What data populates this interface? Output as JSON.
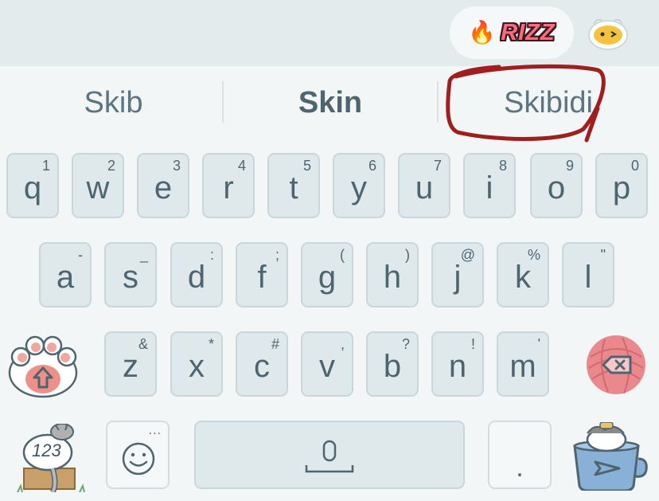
{
  "toolbar": {
    "badge_text": "RIZZ",
    "badge_emoji": "🔥",
    "mascot_icon": "ghost-face-icon"
  },
  "suggestions": [
    "Skib",
    "Skin",
    "Skibidi"
  ],
  "row1": [
    {
      "key": "q",
      "hint": "1"
    },
    {
      "key": "w",
      "hint": "2"
    },
    {
      "key": "e",
      "hint": "3"
    },
    {
      "key": "r",
      "hint": "4"
    },
    {
      "key": "t",
      "hint": "5"
    },
    {
      "key": "y",
      "hint": "6"
    },
    {
      "key": "u",
      "hint": "7"
    },
    {
      "key": "i",
      "hint": "8"
    },
    {
      "key": "o",
      "hint": "9"
    },
    {
      "key": "p",
      "hint": "0"
    }
  ],
  "row2": [
    {
      "key": "a",
      "hint": "-"
    },
    {
      "key": "s",
      "hint": "_"
    },
    {
      "key": "d",
      "hint": ":"
    },
    {
      "key": "f",
      "hint": ";"
    },
    {
      "key": "g",
      "hint": "("
    },
    {
      "key": "h",
      "hint": ")"
    },
    {
      "key": "j",
      "hint": "@"
    },
    {
      "key": "k",
      "hint": "%"
    },
    {
      "key": "l",
      "hint": "\""
    }
  ],
  "row3": [
    {
      "key": "z",
      "hint": "&"
    },
    {
      "key": "x",
      "hint": "*"
    },
    {
      "key": "c",
      "hint": "#"
    },
    {
      "key": "v",
      "hint": ","
    },
    {
      "key": "b",
      "hint": "?"
    },
    {
      "key": "n",
      "hint": "!"
    },
    {
      "key": "m",
      "hint": "'"
    }
  ],
  "bottom": {
    "numbers_label": "123",
    "period_label": ".",
    "emoji_more": "...",
    "space_icon": "microphone-icon",
    "send_icon": "send-icon"
  },
  "colors": {
    "key_bg": "#dfe9ec",
    "key_border": "#c9d7dc",
    "text": "#4e6570",
    "annotation": "#a01e1e",
    "paw_pink": "#f1a6a0",
    "yarn_pink": "#e9888d"
  }
}
